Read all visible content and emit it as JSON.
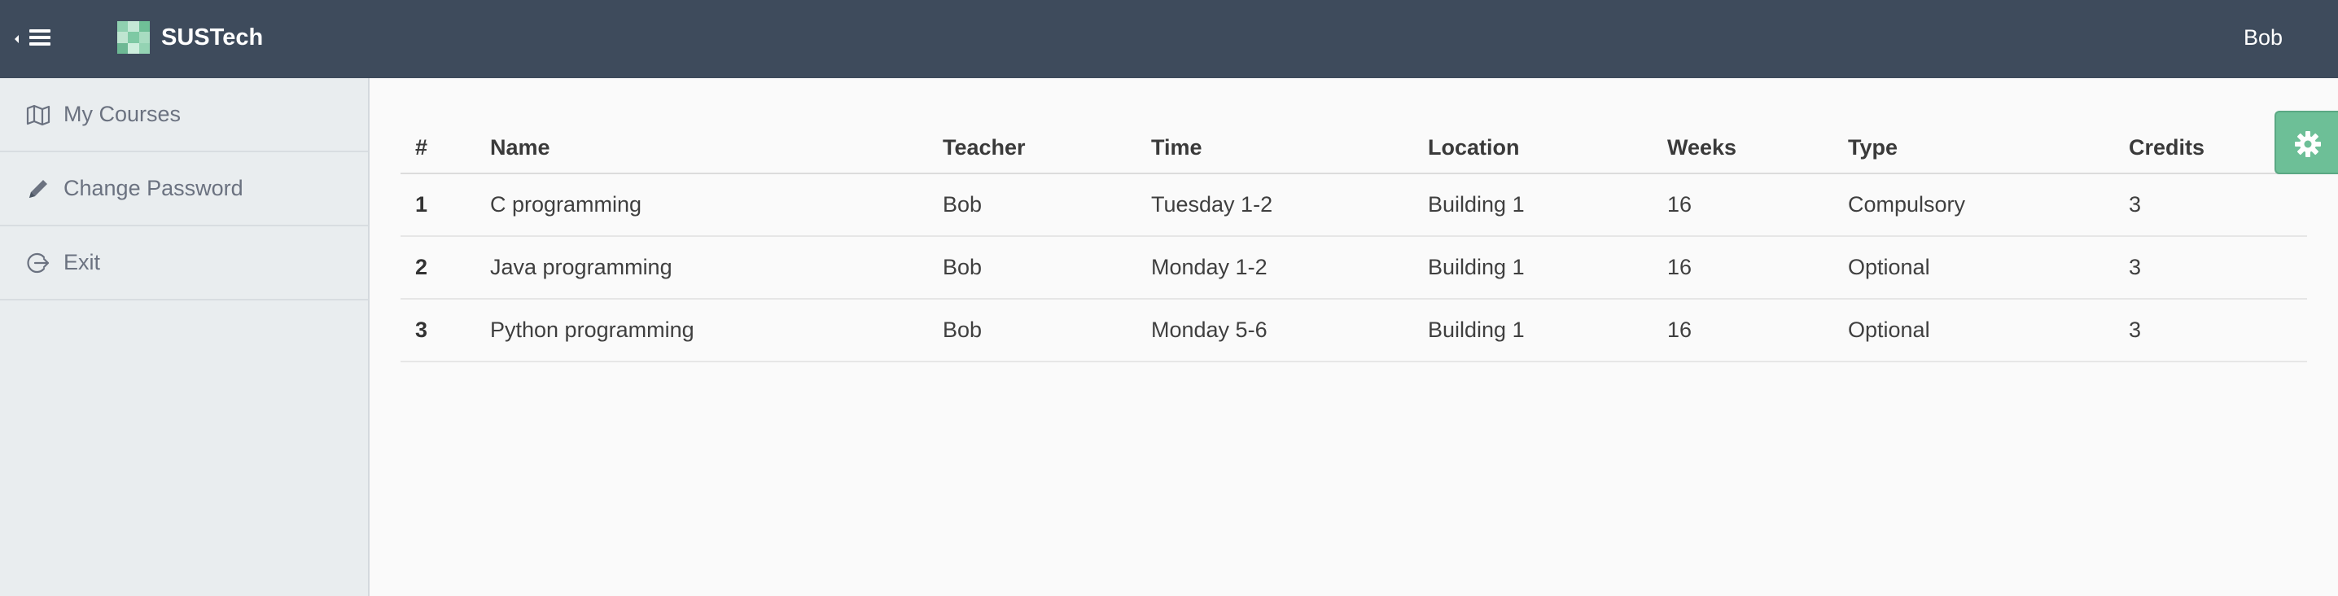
{
  "header": {
    "brand": "SUSTech",
    "user": "Bob",
    "menu_icon": "hamburger-collapse-icon",
    "logo_icon": "checker-logo-icon",
    "colors": {
      "bg": "#3e4b5c",
      "text": "#ffffff"
    }
  },
  "sidebar": {
    "items": [
      {
        "label": "My Courses",
        "icon": "map-icon"
      },
      {
        "label": "Change Password",
        "icon": "pencil-icon"
      },
      {
        "label": "Exit",
        "icon": "logout-icon"
      }
    ]
  },
  "table": {
    "columns": [
      "#",
      "Name",
      "Teacher",
      "Time",
      "Location",
      "Weeks",
      "Type",
      "Credits"
    ],
    "rows": [
      [
        "1",
        "C programming",
        "Bob",
        "Tuesday 1-2",
        "Building 1",
        "16",
        "Compulsory",
        "3"
      ],
      [
        "2",
        "Java programming",
        "Bob",
        "Monday 1-2",
        "Building 1",
        "16",
        "Optional",
        "3"
      ],
      [
        "3",
        "Python programming",
        "Bob",
        "Monday 5-6",
        "Building 1",
        "16",
        "Optional",
        "3"
      ]
    ]
  },
  "settings": {
    "icon": "gear-icon",
    "color": "#6dbf97"
  }
}
